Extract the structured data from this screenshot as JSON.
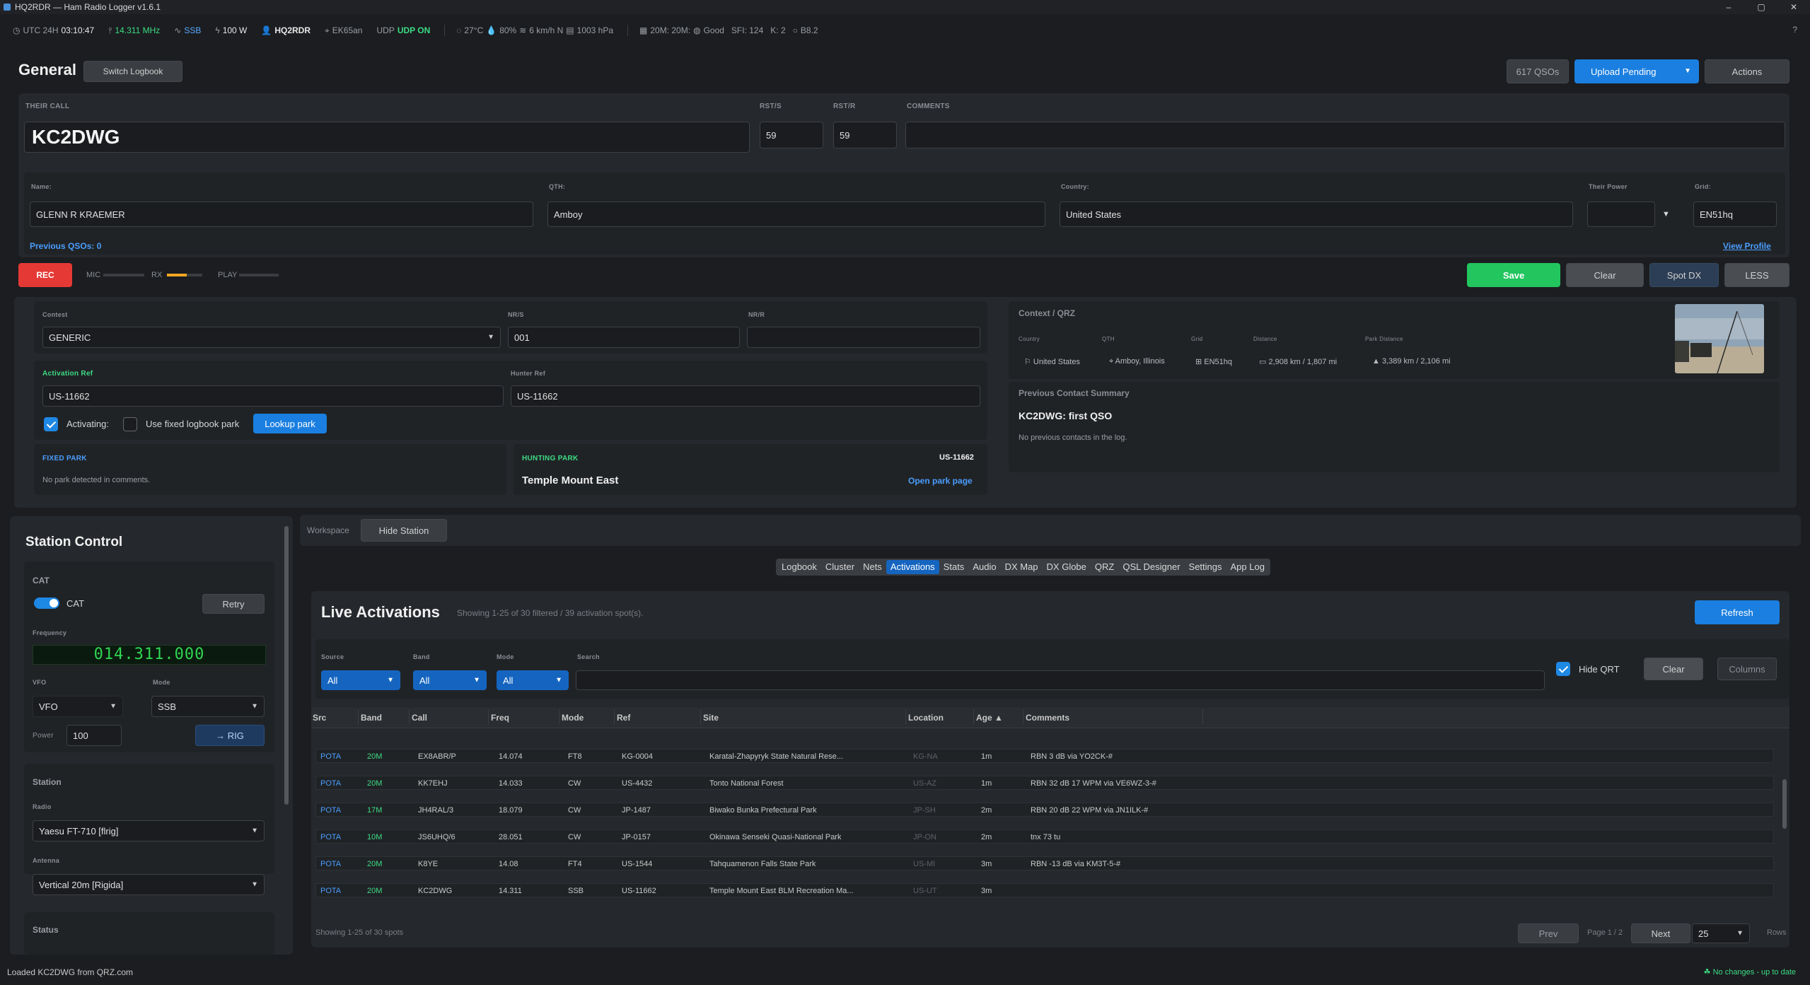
{
  "window": {
    "title": "HQ2RDR — Ham Radio Logger  v1.6.1",
    "controls": [
      "–",
      "▢",
      "✕"
    ]
  },
  "status": {
    "utc": "UTC 24H",
    "time": "03:10:47",
    "freq": "14.311 MHz",
    "mode": "SSB",
    "power": "100 W",
    "call": "HQ2RDR",
    "grid": "EK65an",
    "udp_label": "UDP",
    "udp": "UDP ON",
    "temp": "27°C",
    "humidity": "80%",
    "wind": "6 km/h N",
    "pressure": "1003 hPa",
    "band_cond": "20M: 20M:",
    "cond": "Good",
    "sfi": "SFI: 124",
    "k": "K: 2",
    "b": "B8.2",
    "help": "?"
  },
  "header": {
    "title": "General",
    "switch": "Switch Logbook",
    "qsos": "617 QSOs",
    "upload": "Upload Pending",
    "actions": "Actions"
  },
  "entry": {
    "their_call_label": "THEIR CALL",
    "their_call": "KC2DWG",
    "rsts_label": "RST/S",
    "rsts": "59",
    "rstr_label": "RST/R",
    "rstr": "59",
    "comments_label": "COMMENTS",
    "comments": "",
    "name_label": "Name:",
    "name": "GLENN R KRAEMER",
    "qth_label": "QTH:",
    "qth": "Amboy",
    "country_label": "Country:",
    "country": "United States",
    "power_label": "Their Power",
    "power": "",
    "grid_label": "Grid:",
    "grid": "EN51hq",
    "prev": "Previous QSOs: 0",
    "view": "View Profile"
  },
  "audio": {
    "rec": "REC",
    "mic": "MIC",
    "rx": "RX",
    "play": "PLAY",
    "rx_level": 0.55,
    "save": "Save",
    "clear": "Clear",
    "spot": "Spot DX",
    "less": "LESS"
  },
  "contest": {
    "contest_label": "Contest",
    "contest": "GENERIC",
    "nrs_label": "NR/S",
    "nrs": "001",
    "nrr_label": "NR/R",
    "nrr": "",
    "act_label": "Activation Ref",
    "act": "US-11662",
    "hunter_label": "Hunter Ref",
    "hunter": "US-11662",
    "activating": "Activating:",
    "fixed_cb": "Use fixed logbook park",
    "lookup": "Lookup park",
    "fixed_title": "FIXED PARK",
    "fixed_text": "No park detected in comments.",
    "hunting_title": "HUNTING PARK",
    "hunting_ref": "US-11662",
    "hunting_name": "Temple Mount East",
    "open_park": "Open park page"
  },
  "qrz": {
    "title": "Context / QRZ",
    "country_h": "Country",
    "qth_h": "QTH",
    "grid_h": "Grid",
    "dist_h": "Distance",
    "park_h": "Park Distance",
    "country": "United States",
    "qth": "Amboy, Illinois",
    "grid": "EN51hq",
    "dist": "2,908 km / 1,807 mi",
    "park": "3,389 km / 2,106 mi",
    "prev_title": "Previous Contact Summary",
    "prev_head": "KC2DWG: first QSO",
    "prev_text": "No previous contacts in the log."
  },
  "station": {
    "title": "Station Control",
    "cat_h": "CAT",
    "cat": "CAT",
    "retry": "Retry",
    "freq_label": "Frequency",
    "freq": "014.311.000",
    "vfo_label": "VFO",
    "vfo": "VFO",
    "mode_label": "Mode",
    "mode": "SSB",
    "power_label": "Power",
    "power": "100",
    "rig": "→ RIG",
    "st_h": "Station",
    "radio_label": "Radio",
    "radio": "Yaesu FT-710 [flrig]",
    "ant_label": "Antenna",
    "ant": "Vertical 20m [Rigida]",
    "status_h": "Status"
  },
  "workspace": {
    "label": "Workspace",
    "hide": "Hide Station",
    "tabs": [
      "Logbook",
      "Cluster",
      "Nets",
      "Activations",
      "Stats",
      "Audio",
      "DX Map",
      "DX Globe",
      "QRZ",
      "QSL Designer",
      "Settings",
      "App Log"
    ],
    "active": "Activations"
  },
  "live": {
    "title": "Live Activations",
    "summary": "Showing 1-25 of 30 filtered / 39 activation spot(s).",
    "refresh": "Refresh",
    "source_label": "Source",
    "band_label": "Band",
    "mode_label": "Mode",
    "search_label": "Search",
    "source": "All",
    "band": "All",
    "mode": "All",
    "search": "",
    "hide_qrt": "Hide QRT",
    "clear": "Clear",
    "columns": "Columns",
    "headers": [
      "Src",
      "Band",
      "Call",
      "Freq",
      "Mode",
      "Ref",
      "Site",
      "Location",
      "Age ▲",
      "Comments"
    ],
    "rows": [
      [
        "POTA",
        "20M",
        "EX8ABR/P",
        "14.074",
        "FT8",
        "KG-0004",
        "Karatal-Zhapyryk State Natural Rese...",
        "KG-NA",
        "1m",
        "RBN 3 dB via YO2CK-#"
      ],
      [
        "POTA",
        "20M",
        "KK7EHJ",
        "14.033",
        "CW",
        "US-4432",
        "Tonto National Forest",
        "US-AZ",
        "1m",
        "RBN 32 dB 17 WPM via VE6WZ-3-#"
      ],
      [
        "POTA",
        "17M",
        "JH4RAL/3",
        "18.079",
        "CW",
        "JP-1487",
        "Biwako Bunka Prefectural Park",
        "JP-SH",
        "2m",
        "RBN 20 dB 22 WPM via JN1ILK-#"
      ],
      [
        "POTA",
        "10M",
        "JS6UHQ/6",
        "28.051",
        "CW",
        "JP-0157",
        "Okinawa Senseki Quasi-National Park",
        "JP-ON",
        "2m",
        "tnx 73 tu"
      ],
      [
        "POTA",
        "20M",
        "K8YE",
        "14.08",
        "FT4",
        "US-1544",
        "Tahquamenon Falls State Park",
        "US-MI",
        "3m",
        "RBN -13 dB via KM3T-5-#"
      ],
      [
        "POTA",
        "20M",
        "KC2DWG",
        "14.311",
        "SSB",
        "US-11662",
        "Temple Mount East BLM Recreation Ma...",
        "US-UT",
        "3m",
        ""
      ]
    ],
    "footer": "Showing 1-25 of 30 spots",
    "prev": "Prev",
    "page": "Page 1 / 2",
    "next": "Next",
    "rows_val": "25",
    "rows_label": "Rows"
  },
  "bottom": {
    "left": "Loaded KC2DWG from QRZ.com",
    "right": "No changes - up to date"
  }
}
